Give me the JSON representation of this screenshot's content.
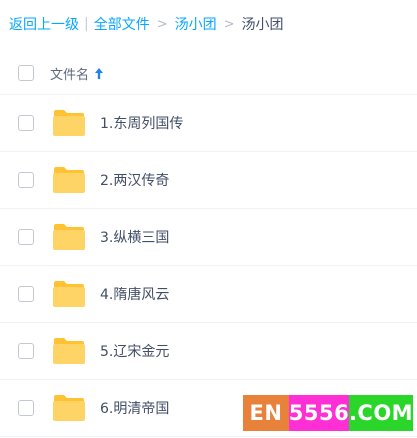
{
  "breadcrumb": {
    "back": "返回上一级",
    "separator_bar": "|",
    "all_files": "全部文件",
    "separator_gt": ">",
    "parent": "汤小团",
    "current": "汤小团"
  },
  "list_header": {
    "column_name": "文件名"
  },
  "files": [
    {
      "name": "1.东周列国传"
    },
    {
      "name": "2.两汉传奇"
    },
    {
      "name": "3.纵横三国"
    },
    {
      "name": "4.隋唐风云"
    },
    {
      "name": "5.辽宋金元"
    },
    {
      "name": "6.明清帝国"
    }
  ],
  "watermark": {
    "part1": "EN",
    "part2": "5556",
    "part3": ".COM",
    "colors": [
      "#e8813a",
      "#ff2fd6",
      "#2bd62b"
    ]
  },
  "colors": {
    "link": "#06a7ff",
    "folder": "#ffd466",
    "folder_tab": "#ffc233",
    "sort_arrow": "#1e83f0"
  }
}
